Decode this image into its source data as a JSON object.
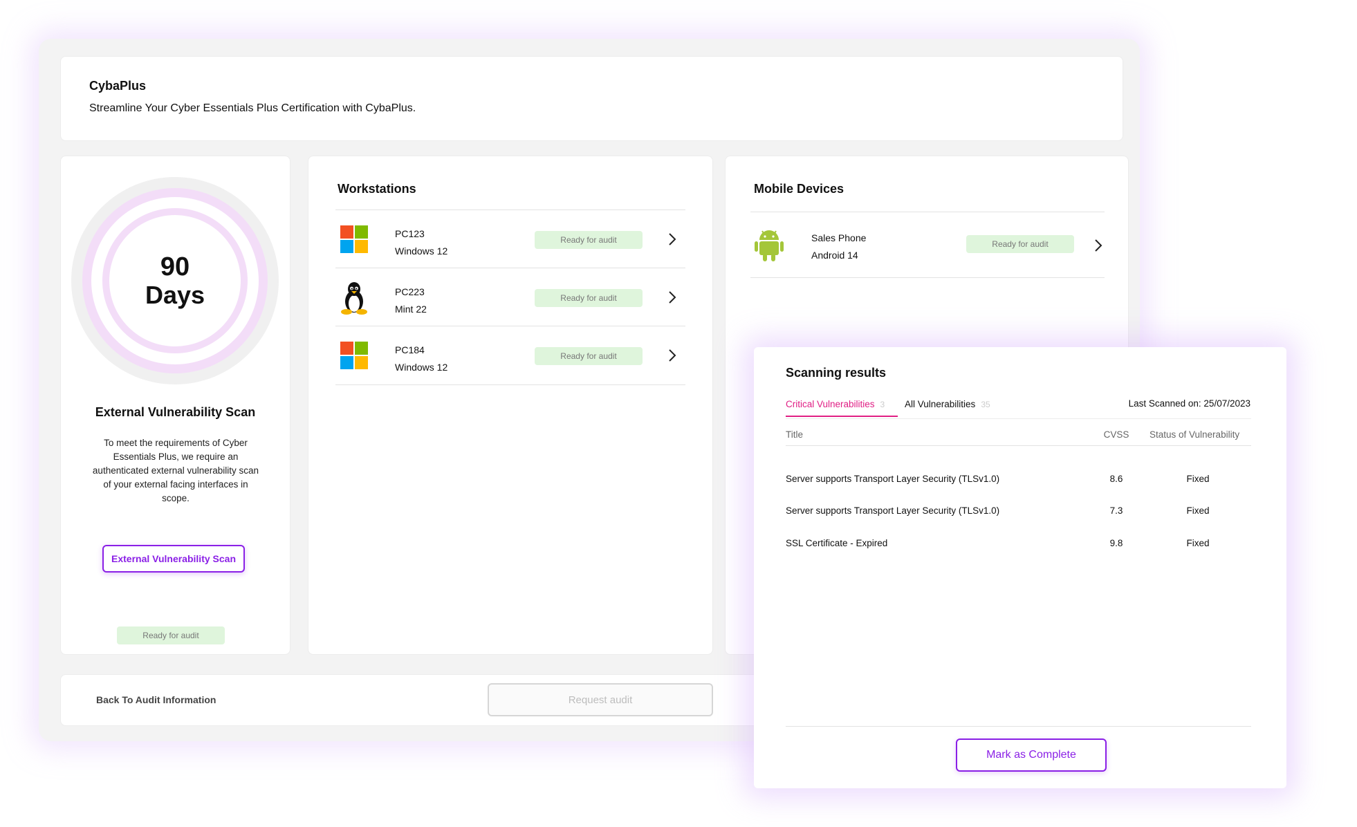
{
  "header": {
    "title": "CybaPlus",
    "subtitle": "Streamline Your Cyber Essentials Plus Certification with CybaPlus."
  },
  "scan_panel": {
    "days_number": "90",
    "days_label": "Days",
    "title": "External Vulnerability Scan",
    "description": "To meet the requirements of Cyber Essentials Plus, we require an authenticated external vulnerability scan of your external facing interfaces in scope.",
    "button_label": "External  Vulnerability Scan",
    "status": "Ready for audit"
  },
  "workstations": {
    "title": "Workstations",
    "items": [
      {
        "name": "PC123",
        "os": "Windows 12",
        "icon": "windows-icon",
        "status": "Ready for audit"
      },
      {
        "name": "PC223",
        "os": "Mint 22",
        "icon": "linux-icon",
        "status": "Ready for audit"
      },
      {
        "name": "PC184",
        "os": "Windows 12",
        "icon": "windows-icon",
        "status": "Ready for audit"
      }
    ]
  },
  "mobile_devices": {
    "title": "Mobile Devices",
    "items": [
      {
        "name": "Sales Phone",
        "os": "Android 14",
        "icon": "android-icon",
        "status": "Ready for audit"
      }
    ]
  },
  "bottom_bar": {
    "back_label": "Back To Audit Information",
    "request_label": "Request audit"
  },
  "scanning_results": {
    "title": "Scanning results",
    "tabs": [
      {
        "label": "Critical Vulnerabilities",
        "count": "3",
        "active": true
      },
      {
        "label": "All Vulnerabilities",
        "count": "35",
        "active": false
      }
    ],
    "last_scanned": "Last Scanned on: 25/07/2023",
    "columns": [
      "Title",
      "CVSS",
      "Status of Vulnerability"
    ],
    "rows": [
      {
        "title": "Server supports Transport Layer Security (TLSv1.0)",
        "cvss": "8.6",
        "status": "Fixed"
      },
      {
        "title": "Server supports Transport Layer Security (TLSv1.0)",
        "cvss": "7.3",
        "status": "Fixed"
      },
      {
        "title": "SSL Certificate - Expired",
        "cvss": "9.8",
        "status": "Fixed"
      }
    ],
    "complete_label": "Mark as Complete"
  },
  "colors": {
    "accent_purple": "#8a1fe6",
    "accent_pink": "#e01e84",
    "ready_bg": "#dff5dc",
    "ring": "#f3ddf8"
  }
}
